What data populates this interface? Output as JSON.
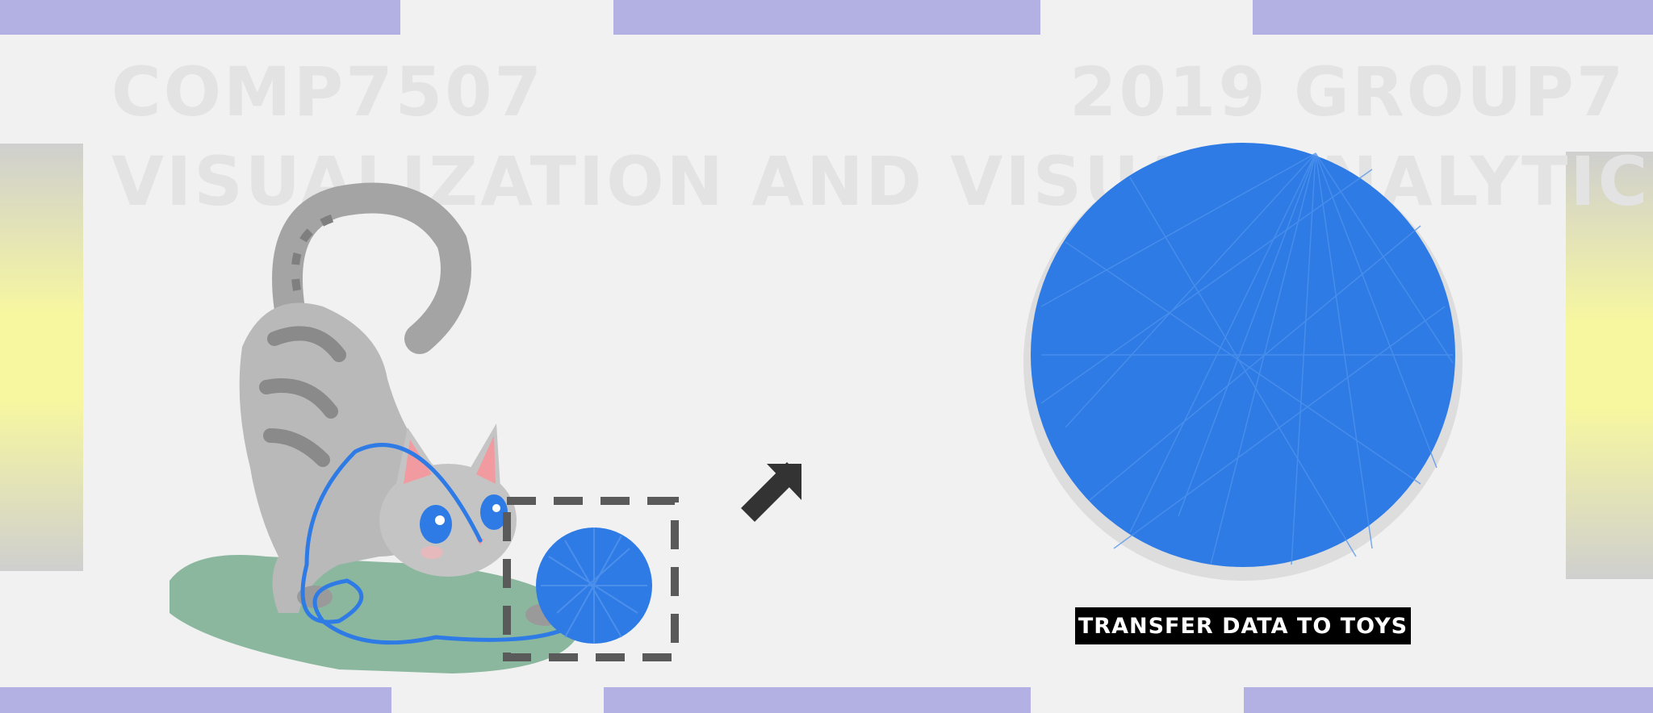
{
  "header": {
    "course_code": "COMP7507",
    "year_group": "2019 GROUP7",
    "course_title": "VISUALIZATION AND VISUAL ANALYTICS"
  },
  "caption": "TRANSFER DATA TO TOYS",
  "colors": {
    "bar": "#b3b0e3",
    "yarn_blue": "#2e7be6",
    "side_panel_yellow": "#f7f7a0",
    "watermark_gray": "#e3e3e3"
  },
  "icons": {
    "arrow": "arrow-up-right-icon",
    "cat": "cat-illustration",
    "yarn_small": "yarn-ball-small",
    "yarn_large": "yarn-ball-large"
  }
}
